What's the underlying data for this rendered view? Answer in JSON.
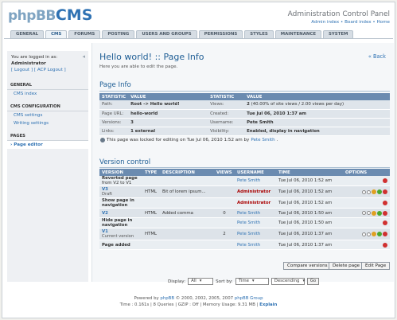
{
  "header": {
    "logo_part1": "phpBB",
    "logo_part2": "CMS",
    "title": "Administration Control Panel",
    "links": [
      "Admin index",
      "Board index",
      "Home"
    ],
    "link_sep": " • "
  },
  "tabs": [
    "GENERAL",
    "CMS",
    "FORUMS",
    "POSTING",
    "USERS AND GROUPS",
    "PERMISSIONS",
    "STYLES",
    "MAINTENANCE",
    "SYSTEM"
  ],
  "active_tab": "CMS",
  "sidebar": {
    "login_text": "You are logged in as:",
    "username": "Administrator",
    "logout": "[ Logout ]",
    "acp_logout": "[ ACP Logout ]",
    "sections": [
      {
        "title": "GENERAL",
        "items": [
          "CMS index"
        ]
      },
      {
        "title": "CMS CONFIGURATION",
        "items": [
          "CMS settings",
          "Writing settings"
        ]
      },
      {
        "title": "PAGES",
        "items": [
          "Page editor"
        ]
      }
    ]
  },
  "main": {
    "title": "Hello world! :: Page Info",
    "description": "Here you are able to edit the page.",
    "back": "« Back"
  },
  "page_info": {
    "title": "Page Info",
    "headers": [
      "STATISTIC",
      "VALUE",
      "STATISTIC",
      "VALUE"
    ],
    "rows": [
      [
        "Path:",
        "Root -> Hello world!",
        "Views:",
        "2",
        "(40.00% of site views / 2.00 views per day)"
      ],
      [
        "Page URL:",
        "hello-world",
        "Created:",
        "Tue Jul 06, 2010 1:37 am",
        ""
      ],
      [
        "Versions:",
        "3",
        "Username:",
        "Pete Smith",
        ""
      ],
      [
        "Links:",
        "1 external",
        "Visibility:",
        "Enabled, display in navigation",
        ""
      ]
    ],
    "lock_prefix": "This page was locked for editing on Tue Jul 06, 2010 1:52 am by",
    "lock_user": "Pete Smith",
    "lock_suffix": "."
  },
  "version_control": {
    "title": "Version control",
    "headers": [
      "VERSION",
      "TYPE",
      "DESCRIPTION",
      "VIEWS",
      "USERNAME",
      "TIME",
      "OPTIONS"
    ],
    "rows": [
      {
        "version": "Reverted page",
        "version_sub": "from V2 to V1",
        "type": "",
        "desc": "",
        "views": "",
        "user": "Pete Smith",
        "admin": false,
        "time": "Tue Jul 06, 2010 1:52 am",
        "opts": "red"
      },
      {
        "version": "V3",
        "version_sub": "Draft",
        "type": "HTML",
        "desc": "Bit of lorem ipsum...",
        "views": "",
        "user": "Administrator",
        "admin": true,
        "time": "Tue Jul 06, 2010 1:52 am",
        "opts": "full"
      },
      {
        "version": "Show page in navigation",
        "version_sub": "",
        "type": "",
        "desc": "",
        "views": "",
        "user": "Administrator",
        "admin": true,
        "time": "Tue Jul 06, 2010 1:52 am",
        "opts": "red"
      },
      {
        "version": "V2",
        "version_sub": "",
        "type": "HTML",
        "desc": "Added comma",
        "views": "0",
        "user": "Pete Smith",
        "admin": false,
        "time": "Tue Jul 06, 2010 1:50 am",
        "opts": "full"
      },
      {
        "version": "Hide page in navigation",
        "version_sub": "",
        "type": "",
        "desc": "",
        "views": "",
        "user": "Pete Smith",
        "admin": false,
        "time": "Tue Jul 06, 2010 1:50 am",
        "opts": "red"
      },
      {
        "version": "V1",
        "version_sub": "Current version",
        "type": "HTML",
        "desc": "",
        "views": "2",
        "user": "Pete Smith",
        "admin": false,
        "time": "Tue Jul 06, 2010 1:37 am",
        "opts": "full"
      },
      {
        "version": "Page added",
        "version_sub": "",
        "type": "",
        "desc": "",
        "views": "",
        "user": "Pete Smith",
        "admin": false,
        "time": "Tue Jul 06, 2010 1:37 am",
        "opts": "red"
      }
    ],
    "buttons": {
      "compare": "Compare versions",
      "delete": "Delete page",
      "edit": "Edit Page"
    }
  },
  "filter": {
    "display_label": "Display:",
    "display_value": "All",
    "sort_label": "Sort by:",
    "sort_value": "Time",
    "order_value": "Descending",
    "go": "Go"
  },
  "footer": {
    "line1_prefix": "Powered by",
    "line1_link": "phpBB",
    "line1_suffix": "© 2000, 2002, 2005, 2007",
    "line1_group": "phpBB Group",
    "line2": "Time : 0.161s | 8 Queries | GZIP : Off | Memory Usage: 9.31 MB |",
    "line2_link": "Explain"
  },
  "colors": {
    "accent": "#2f72b3",
    "table_header": "#6b8bb0",
    "admin": "#aa0000"
  }
}
